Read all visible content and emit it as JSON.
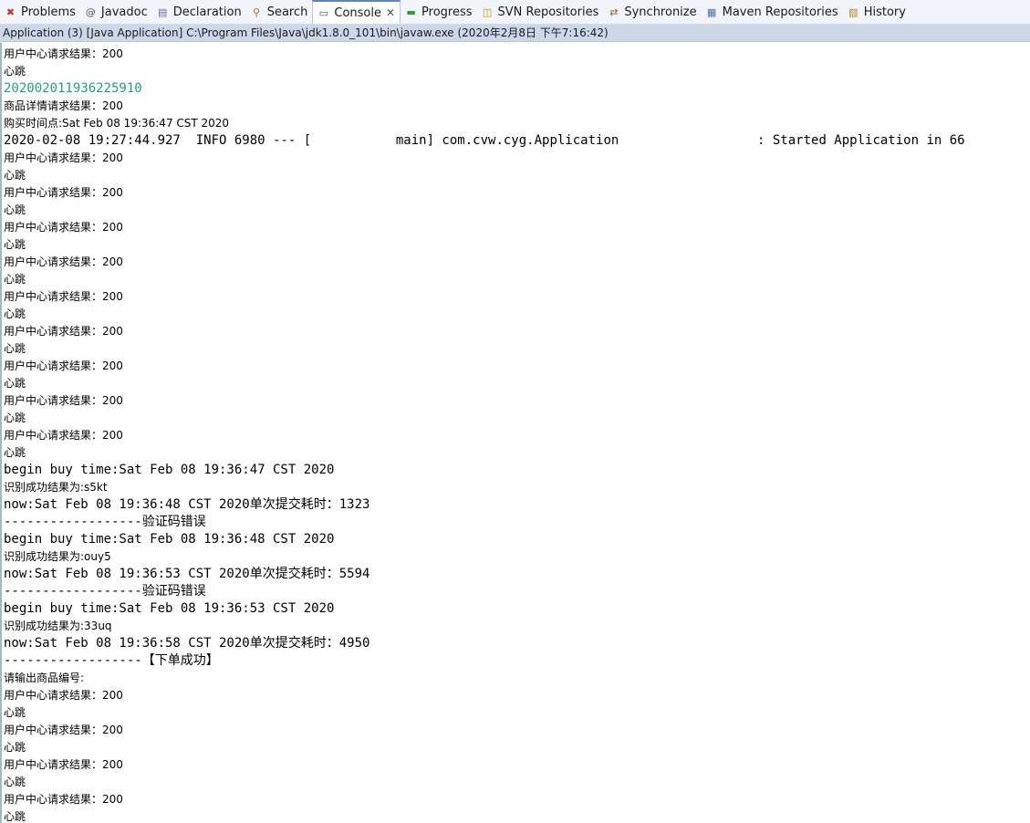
{
  "tabs": [
    {
      "label": "Problems",
      "icon": "problems-icon",
      "active": false
    },
    {
      "label": "Javadoc",
      "icon": "javadoc-icon",
      "active": false
    },
    {
      "label": "Declaration",
      "icon": "declaration-icon",
      "active": false
    },
    {
      "label": "Search",
      "icon": "search-icon",
      "active": false
    },
    {
      "label": "Console",
      "icon": "console-icon",
      "active": true
    },
    {
      "label": "Progress",
      "icon": "progress-icon",
      "active": false
    },
    {
      "label": "SVN Repositories",
      "icon": "svn-repositories-icon",
      "active": false
    },
    {
      "label": "Synchronize",
      "icon": "synchronize-icon",
      "active": false
    },
    {
      "label": "Maven Repositories",
      "icon": "maven-repositories-icon",
      "active": false
    },
    {
      "label": "History",
      "icon": "history-icon",
      "active": false
    }
  ],
  "console_title": "Application (3) [Java Application] C:\\Program Files\\Java\\jdk1.8.0_101\\bin\\javaw.exe (2020年2月8日 下午7:16:42)",
  "console_lines": [
    {
      "text": "用户中心请求结果：200",
      "mono": false,
      "green": false
    },
    {
      "text": "心跳",
      "mono": false,
      "green": false
    },
    {
      "text": "202002011936225910",
      "mono": true,
      "green": true
    },
    {
      "text": "商品详情请求结果：200",
      "mono": false,
      "green": false
    },
    {
      "text": "购买时间点:Sat Feb 08 19:36:47 CST 2020",
      "mono": false,
      "green": false
    },
    {
      "text": "2020-02-08 19:27:44.927  INFO 6980 --- [           main] com.cvw.cyg.Application                  : Started Application in 66",
      "mono": true,
      "green": false
    },
    {
      "text": "用户中心请求结果：200",
      "mono": false,
      "green": false
    },
    {
      "text": "心跳",
      "mono": false,
      "green": false
    },
    {
      "text": "用户中心请求结果：200",
      "mono": false,
      "green": false
    },
    {
      "text": "心跳",
      "mono": false,
      "green": false
    },
    {
      "text": "用户中心请求结果：200",
      "mono": false,
      "green": false
    },
    {
      "text": "心跳",
      "mono": false,
      "green": false
    },
    {
      "text": "用户中心请求结果：200",
      "mono": false,
      "green": false
    },
    {
      "text": "心跳",
      "mono": false,
      "green": false
    },
    {
      "text": "用户中心请求结果：200",
      "mono": false,
      "green": false
    },
    {
      "text": "心跳",
      "mono": false,
      "green": false
    },
    {
      "text": "用户中心请求结果：200",
      "mono": false,
      "green": false
    },
    {
      "text": "心跳",
      "mono": false,
      "green": false
    },
    {
      "text": "用户中心请求结果：200",
      "mono": false,
      "green": false
    },
    {
      "text": "心跳",
      "mono": false,
      "green": false
    },
    {
      "text": "用户中心请求结果：200",
      "mono": false,
      "green": false
    },
    {
      "text": "心跳",
      "mono": false,
      "green": false
    },
    {
      "text": "用户中心请求结果：200",
      "mono": false,
      "green": false
    },
    {
      "text": "心跳",
      "mono": false,
      "green": false
    },
    {
      "text": "begin buy time:Sat Feb 08 19:36:47 CST 2020",
      "mono": true,
      "green": false
    },
    {
      "text": "识别成功结果为:s5kt",
      "mono": false,
      "green": false
    },
    {
      "text": "now:Sat Feb 08 19:36:48 CST 2020单次提交耗时：1323",
      "mono": true,
      "green": false
    },
    {
      "text": "------------------验证码错误",
      "mono": true,
      "green": false
    },
    {
      "text": "begin buy time:Sat Feb 08 19:36:48 CST 2020",
      "mono": true,
      "green": false
    },
    {
      "text": "识别成功结果为:ouy5",
      "mono": false,
      "green": false
    },
    {
      "text": "now:Sat Feb 08 19:36:53 CST 2020单次提交耗时：5594",
      "mono": true,
      "green": false
    },
    {
      "text": "------------------验证码错误",
      "mono": true,
      "green": false
    },
    {
      "text": "begin buy time:Sat Feb 08 19:36:53 CST 2020",
      "mono": true,
      "green": false
    },
    {
      "text": "识别成功结果为:33uq",
      "mono": false,
      "green": false
    },
    {
      "text": "now:Sat Feb 08 19:36:58 CST 2020单次提交耗时：4950",
      "mono": true,
      "green": false
    },
    {
      "text": "------------------【下单成功】",
      "mono": true,
      "green": false
    },
    {
      "text": "请输出商品编号:",
      "mono": false,
      "green": false
    },
    {
      "text": "用户中心请求结果：200",
      "mono": false,
      "green": false
    },
    {
      "text": "心跳",
      "mono": false,
      "green": false
    },
    {
      "text": "用户中心请求结果：200",
      "mono": false,
      "green": false
    },
    {
      "text": "心跳",
      "mono": false,
      "green": false
    },
    {
      "text": "用户中心请求结果：200",
      "mono": false,
      "green": false
    },
    {
      "text": "心跳",
      "mono": false,
      "green": false
    },
    {
      "text": "用户中心请求结果：200",
      "mono": false,
      "green": false
    },
    {
      "text": "心跳",
      "mono": false,
      "green": false
    }
  ],
  "colors": {
    "tabbar_bg": "#f1f4f9",
    "statusbar_bg": "#ccd8e8",
    "green_text": "#1fa37a",
    "console_bg": "#ffffff"
  }
}
